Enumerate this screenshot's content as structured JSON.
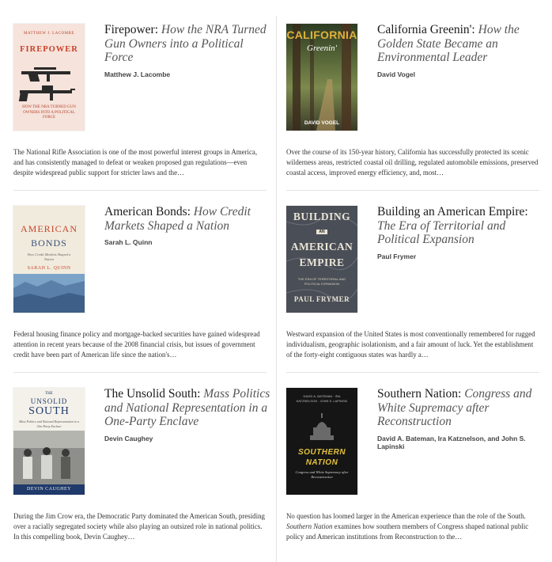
{
  "books": [
    {
      "title_main": "Firepower:",
      "title_sub": "How the NRA Turned Gun Owners into a Political Force",
      "author": "Matthew J. Lacombe",
      "description": "The National Rifle Association is one of the most powerful interest groups in America, and has consistently managed to defeat or weaken proposed gun regulations—even despite widespread public support for stricter laws and the…",
      "cover": {
        "author": "MATTHEW J. LACOMBE",
        "title": "FIREPOWER",
        "subtitle": "HOW THE NRA TURNED GUN OWNERS INTO A POLITICAL FORCE",
        "bg": "#f6e3db",
        "accent": "#c9402a"
      }
    },
    {
      "title_main": "California Greenin':",
      "title_sub": "How the Golden State Became an Environmental Leader",
      "author": "David Vogel",
      "description": "Over the course of its 150-year history, California has successfully protected its scenic wilderness areas, restricted coastal oil drilling, regulated automobile emissions, preserved coastal access, improved energy efficiency, and, most…",
      "cover": {
        "title": "CALIFORNIA",
        "title2": "Greenin'",
        "author": "DAVID VOGEL",
        "bg": "#3e4a2a",
        "accent": "#e2b13b"
      }
    },
    {
      "title_main": "American Bonds:",
      "title_sub": "How Credit Markets Shaped a Nation",
      "author": "Sarah L. Quinn",
      "description": "Federal housing finance policy and mortgage-backed securities have gained widespread attention in recent years because of the 2008 financial crisis, but issues of government credit have been part of American life since the nation's…",
      "cover": {
        "title": "AMERICAN",
        "title2": "BONDS",
        "subtitle": "How Credit Markets Shaped a Nation",
        "author": "SARAH L. QUINN",
        "bg": "#f1ebdd",
        "accent": "#c8462e"
      }
    },
    {
      "title_main": "Building an American Empire:",
      "title_sub": "The Era of Territorial and Political Expansion",
      "author": "Paul Frymer",
      "description": "Westward expansion of the United States is most conventionally remembered for rugged individualism, geographic isolationism, and a fair amount of luck. Yet the establishment of the forty-eight contiguous states was hardly a…",
      "cover": {
        "title": "BUILDING",
        "title_an": "AN",
        "title2": "AMERICAN",
        "title3": "EMPIRE",
        "subtitle": "THE ERA OF TERRITORIAL AND POLITICAL EXPANSION",
        "author": "PAUL FRYMER",
        "bg": "#4a4e56",
        "accent": "#e9e4d6"
      }
    },
    {
      "title_main": "The Unsolid South:",
      "title_sub": "Mass Politics and National Representation in a One-Party Enclave",
      "author": "Devin Caughey",
      "description": "During the Jim Crow era, the Democratic Party dominated the American South, presiding over a racially segregated society while also playing an outsized role in national politics. In this compelling book, Devin Caughey…",
      "cover": {
        "title_the": "THE",
        "title": "UNSOLID",
        "title2": "SOUTH",
        "subtitle": "Mass Politics and National Representation in a One-Party Enclave",
        "author": "DEVIN CAUGHEY",
        "bg": "#f4f1ea",
        "accent": "#1f3a6b"
      }
    },
    {
      "title_main": "Southern Nation:",
      "title_sub": "Congress and White Supremacy after Reconstruction",
      "author": "David A. Bateman, Ira Katznelson, and John S. Lapinski",
      "description_pre": "No question has loomed larger in the American experience than the role of the South. ",
      "description_em": "Southern Nation",
      "description_post": " examines how southern members of Congress shaped national public policy and American institutions from Reconstruction to the…",
      "cover": {
        "authors": "DAVID A. BATEMAN · IRA KATZNELSON · JOHN S. LAPINSKI",
        "title": "SOUTHERN",
        "title2": "NATION",
        "subtitle": "Congress and White Supremacy after Reconstruction",
        "bg": "#151515",
        "accent": "#e3c23c"
      }
    }
  ]
}
